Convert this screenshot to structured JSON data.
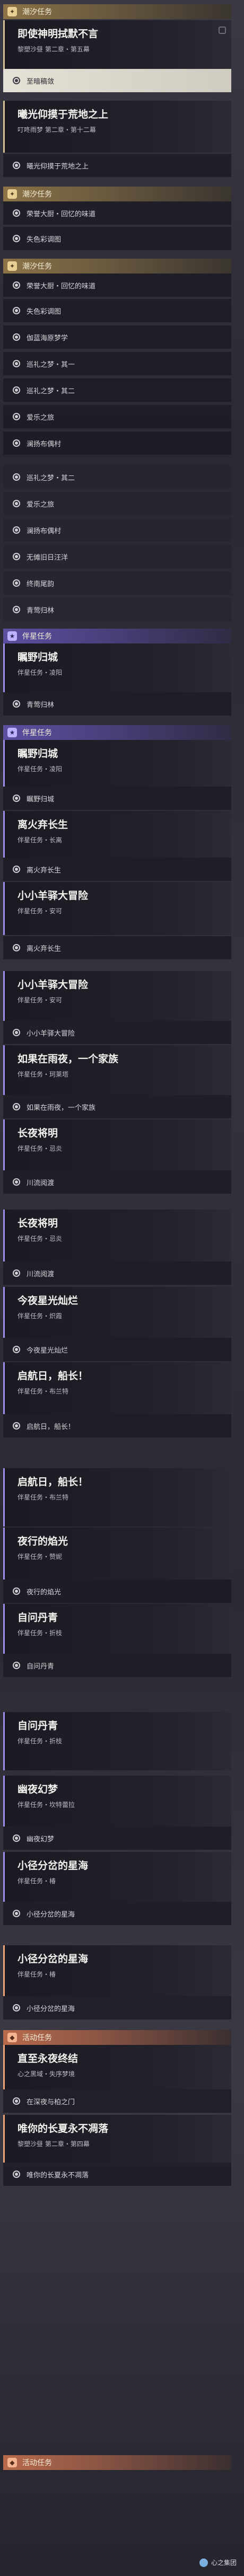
{
  "headers": {
    "h1": "潮汐任务",
    "h2": "潮汐任务",
    "h3": "潮汐任务",
    "h4": "伴星任务",
    "h5": "伴星任务",
    "h6": "活动任务",
    "h7": "活动任务"
  },
  "cards": {
    "c1": {
      "title": "即使神明拭默不言",
      "sub": "黎塑沙昼 第二章・第五幕"
    },
    "c2": {
      "title": "曦光仰摸于荒地之上",
      "sub": "叮咚雨梦 第二章・第十二幕"
    },
    "c3": {
      "title": "瞩野归城",
      "sub": "伴星任务・凌阳"
    },
    "c4": {
      "title": "瞩野归城",
      "sub": "伴星任务・凌阳"
    },
    "c5": {
      "title": "离火弃长生",
      "sub": "伴星任务・长离"
    },
    "c6": {
      "title": "小小羊驿大冒险",
      "sub": "伴星任务・安可"
    },
    "c7": {
      "title": "小小羊驿大冒险",
      "sub": "伴星任务・安可"
    },
    "c8": {
      "title": "如果在雨夜，一个家族",
      "sub": "伴星任务・珂莱塔"
    },
    "c9": {
      "title": "长夜将明",
      "sub": "伴星任务・忌炎"
    },
    "c10": {
      "title": "长夜将明",
      "sub": "伴星任务・忌炎"
    },
    "c11": {
      "title": "今夜星光灿烂",
      "sub": "伴星任务・炽霞"
    },
    "c12": {
      "title": "启航日，船长！",
      "sub": "伴星任务・布兰特"
    },
    "c13": {
      "title": "启航日，船长！",
      "sub": "伴星任务・布兰特"
    },
    "c14": {
      "title": "夜行的焰光",
      "sub": "伴星任务・赞妮"
    },
    "c15": {
      "title": "自问丹青",
      "sub": "伴星任务・折枝"
    },
    "c16": {
      "title": "自问丹青",
      "sub": "伴星任务・折枝"
    },
    "c17": {
      "title": "幽夜幻梦",
      "sub": "伴星任务・坎特蕾拉"
    },
    "c18": {
      "title": "小径分岔的星海",
      "sub": "伴星任务・椿"
    },
    "c19": {
      "title": "小径分岔的星海",
      "sub": "伴星任务・椿"
    },
    "c20": {
      "title": "直至永夜终结",
      "sub": "心之黑域・失序梦境"
    },
    "c21": {
      "title": "唯你的长夏永不凋落",
      "sub": "黎塑沙昼 第二章・第四幕"
    }
  },
  "steps": {
    "s1": "至暗稿敛",
    "s2": "曦光仰摸于荒地之上",
    "s3": "荣誉大厨・回忆的味道",
    "s4": "失色彩调图",
    "s5": "荣誉大厨・回忆的味道",
    "s6": "失色彩调图",
    "s7": "伽蓝海原梦学",
    "s8": "巡礼之梦・其一",
    "s9": "巡礼之梦・其二",
    "s10": "爱乐之旅",
    "s11": "澜扬布偶村",
    "s12": "巡礼之梦・其二",
    "s13": "爱乐之旅",
    "s14": "澜扬布偶村",
    "s15": "无傩旧日汪洋",
    "s16": "终南尾韵",
    "s17": "青莺归林",
    "s18": "青莺归林",
    "s19": "瞩野归城",
    "s20": "离火弃长生",
    "s21": "离火弃长生",
    "s22": "小小羊驿大冒险",
    "s23": "如果在雨夜，一个家族",
    "s24": "川流阅渡",
    "s25": "川流阅渡",
    "s26": "今夜星光灿烂",
    "s27": "启航日，船长！",
    "s28": "夜行的焰光",
    "s29": "自问丹青",
    "s30": "幽夜幻梦",
    "s31": "小径分岔的星海",
    "s32": "小径分岔的星海",
    "s33": "在深夜与柏之门",
    "s34": "唯你的长夏永不凋落"
  },
  "watermark": "心之集团"
}
